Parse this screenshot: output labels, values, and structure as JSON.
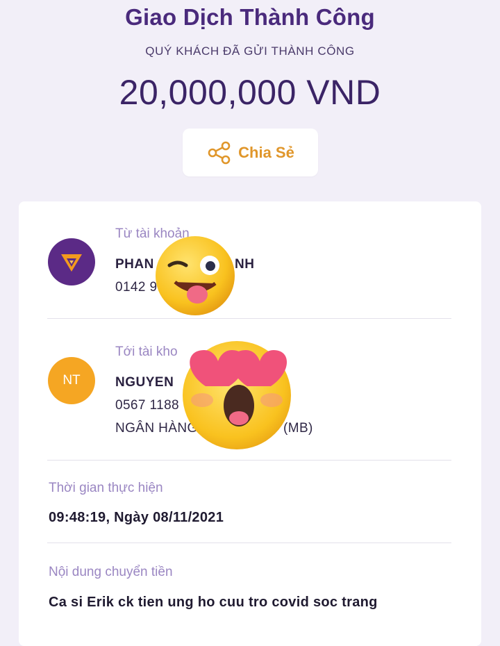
{
  "header": {
    "title": "Giao Dịch Thành Công",
    "subtitle": "QUÝ KHÁCH ĐÃ GỬI THÀNH CÔNG",
    "amount": "20,000,000 VND"
  },
  "share": {
    "label": "Chia Sẻ",
    "icon": "share-icon"
  },
  "from_account": {
    "label": "Từ tài khoản",
    "name": "PHAN",
    "name_tail": "NH",
    "number": "0142 9",
    "avatar_icon": "bank-logo-icon"
  },
  "to_account": {
    "label": "Tới tài kho",
    "initials": "NT",
    "name": "NGUYEN",
    "number": "0567 1188",
    "bank_head": "NGÂN HÀNG",
    "bank_tail": "(MB)"
  },
  "time": {
    "label": "Thời gian thực hiện",
    "value": "09:48:19, Ngày 08/11/2021"
  },
  "note": {
    "label": "Nội dung chuyển tiền",
    "value": "Ca si Erik ck tien ung ho cuu tro covid soc trang"
  },
  "stickers": [
    "winking-tongue-emoji",
    "heart-eyes-emoji"
  ],
  "colors": {
    "accent": "#4a2a7c",
    "share": "#e0962a",
    "nt_avatar": "#f5a623",
    "logo_bg": "#5b2a86"
  }
}
